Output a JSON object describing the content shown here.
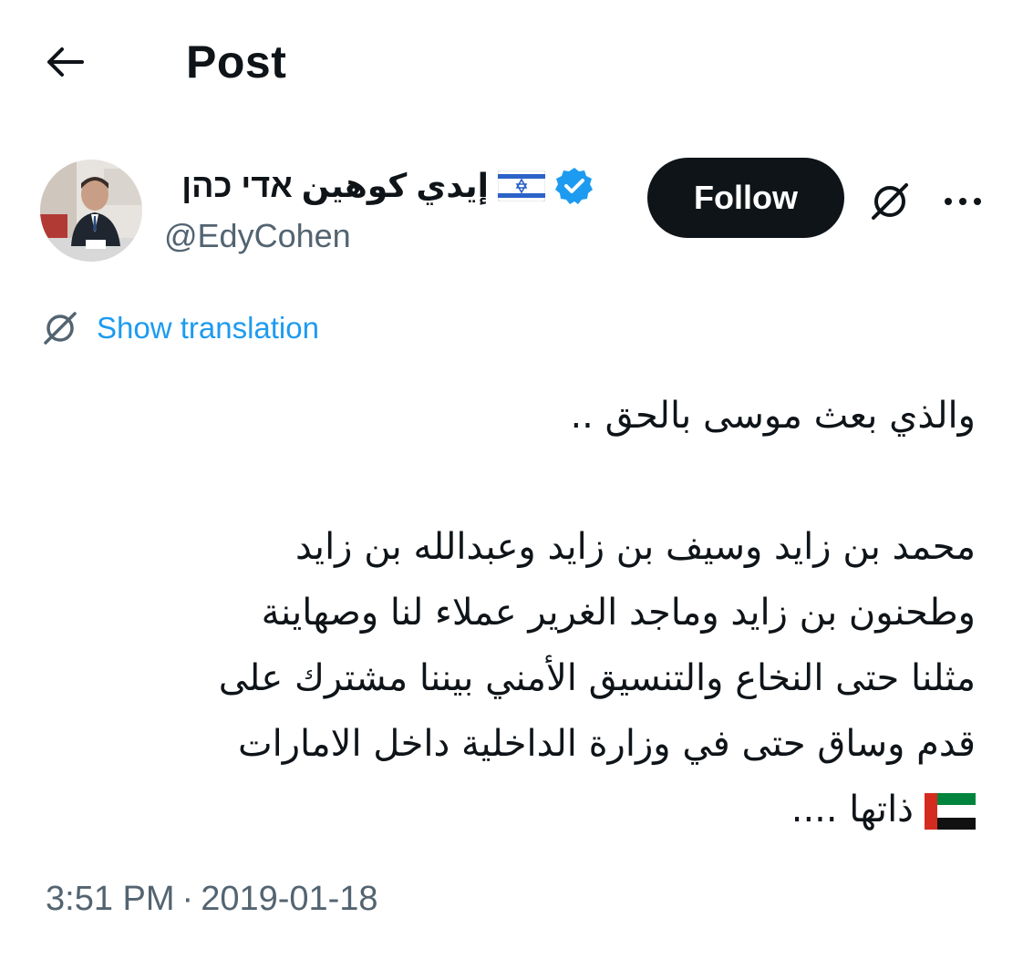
{
  "header": {
    "back_icon": "arrow-left-icon",
    "title": "Post"
  },
  "author": {
    "display_name": "إيدي كوهين אדי כהן",
    "flag_icon": "israel-flag-icon",
    "verified_icon": "verified-badge-icon",
    "verified_color": "#1d9bf0",
    "handle": "@EdyCohen",
    "follow_label": "Follow",
    "grok_icon": "grok-icon",
    "more_icon": "more-dots-icon"
  },
  "translation": {
    "icon": "translate-icon",
    "label": "Show translation",
    "color": "#1d9bf0"
  },
  "tweet": {
    "lines": [
      "والذي بعث موسى بالحق ..",
      "",
      "محمد بن زايد وسيف بن زايد وعبدالله بن زايد",
      "وطحنون بن زايد وماجد الغرير عملاء لنا وصهاينة",
      "مثلنا حتى النخاع والتنسيق الأمني بيننا مشترك على",
      "قدم وساق حتى في وزارة الداخلية داخل الامارات",
      "ذاتها ...."
    ],
    "final_flag_icon": "uae-flag-icon"
  },
  "meta": {
    "time": "3:51 PM",
    "separator": "·",
    "date": "2019-01-18"
  }
}
